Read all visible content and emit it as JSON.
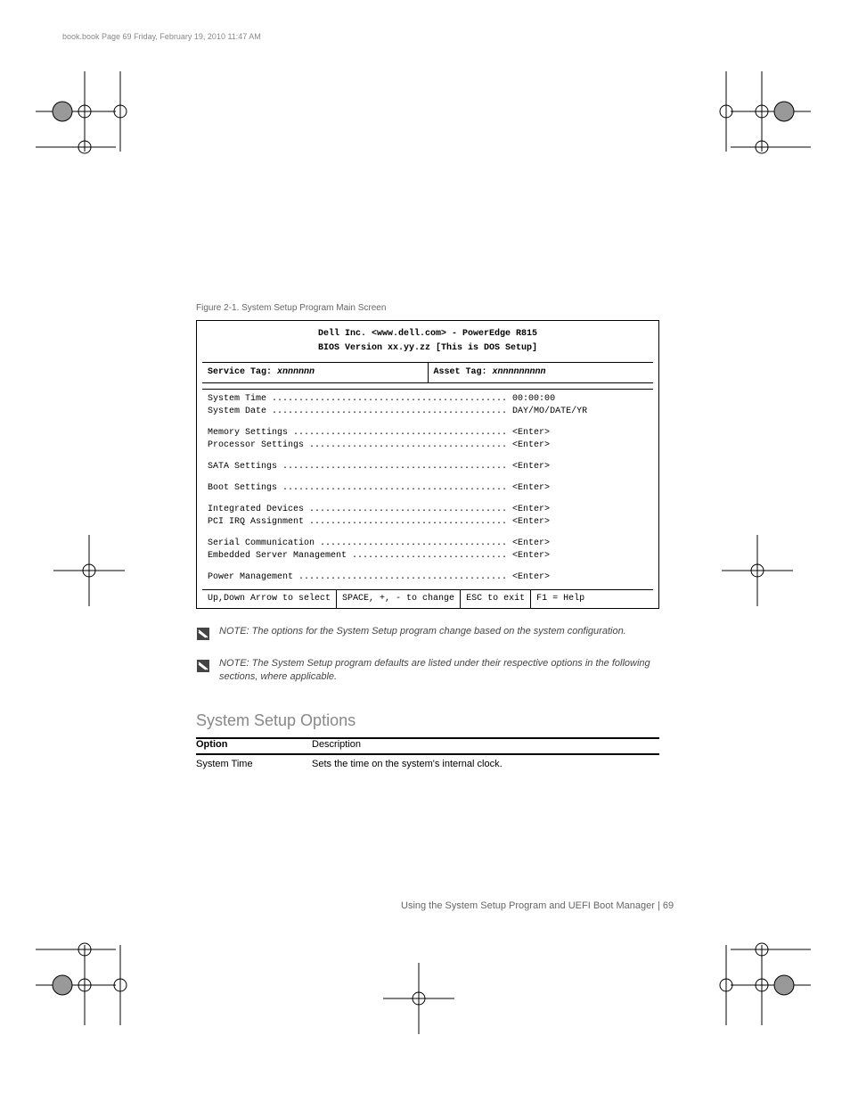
{
  "bookfile": "book.book  Page 69  Friday, February 19, 2010  11:47 AM",
  "figure_caption": "Figure 2-1. System Setup Program Main Screen",
  "bios": {
    "title_line": "Dell Inc. <www.dell.com> - PowerEdge R815",
    "subtitle_line": "BIOS Version xx.yy.zz [This is DOS Setup]",
    "service_tag_label": "Service Tag:",
    "service_tag_value": "xnnnnnn",
    "asset_tag_label": "Asset Tag:",
    "asset_tag_value": "xnnnnnnnnn",
    "menu_groups": [
      [
        "System Time ............................................ 00:00:00",
        "System Date ............................................ DAY/MO/DATE/YR"
      ],
      [
        "Memory Settings ........................................ <Enter>",
        "Processor Settings ..................................... <Enter>"
      ],
      [
        "SATA Settings .......................................... <Enter>"
      ],
      [
        "Boot Settings .......................................... <Enter>"
      ],
      [
        "Integrated Devices ..................................... <Enter>",
        "PCI IRQ Assignment ..................................... <Enter>"
      ],
      [
        "Serial Communication ................................... <Enter>",
        "Embedded Server Management ............................. <Enter>"
      ],
      [
        "Power Management ....................................... <Enter>"
      ]
    ],
    "footer": [
      "Up,Down Arrow to select",
      "SPACE, +, - to change",
      "ESC to exit",
      "F1 = Help"
    ]
  },
  "note1": "NOTE: The options for the System Setup program change based on the system configuration.",
  "note2": "NOTE: The System Setup program defaults are listed under their respective options in the following sections, where applicable.",
  "section_heading": "System Setup Options",
  "option_header_label": "Option",
  "option_header_desc": "Description",
  "option_time_label": "System Time",
  "option_time_desc": "Sets the time on the system's internal clock.",
  "page_number": "Using the System Setup Program and UEFI Boot Manager  |  69"
}
